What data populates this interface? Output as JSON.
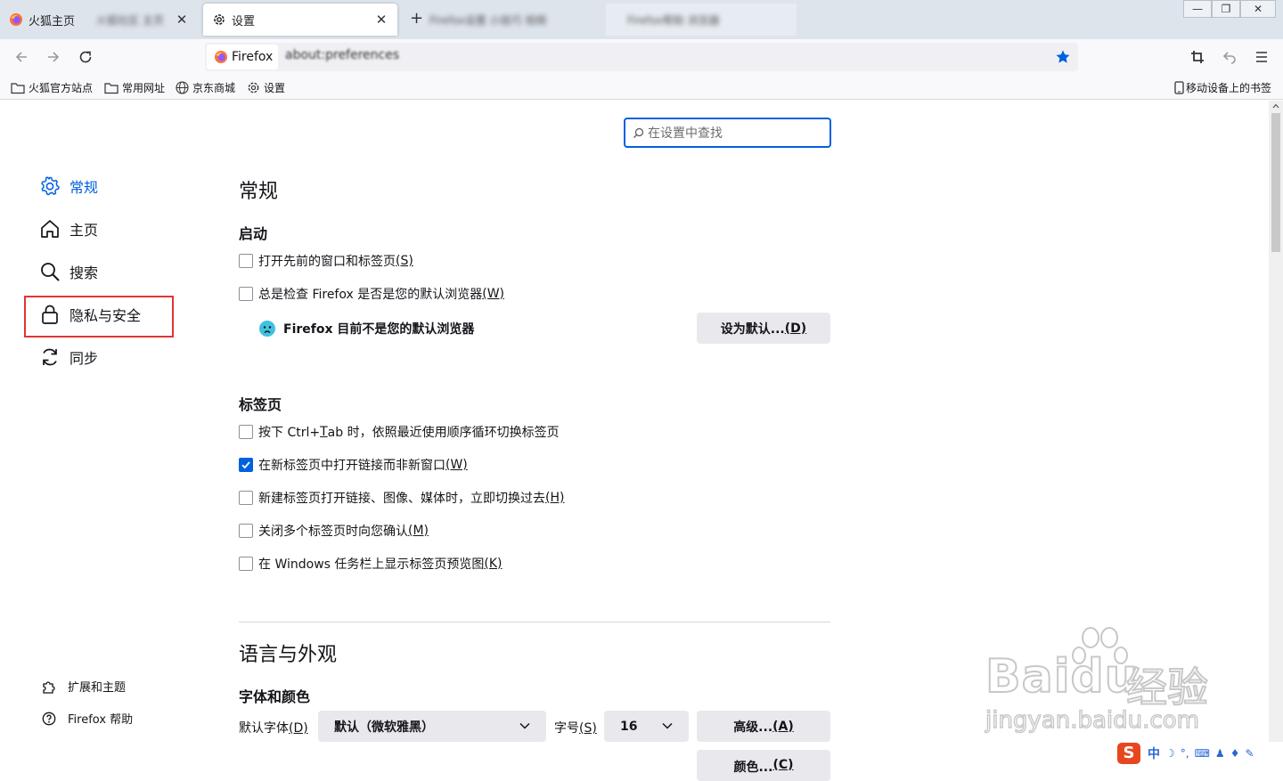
{
  "tabs": [
    {
      "title": "火狐主页",
      "blur_extra": "火狐社区 主页",
      "active": false
    },
    {
      "title": "设置",
      "active": true
    },
    {
      "title": "Firefox设置 小技巧 视频",
      "active": false
    },
    {
      "title": "Firefox帮助 浏览器",
      "active": false
    }
  ],
  "window_controls": {
    "minimize": "—",
    "restore": "❐",
    "close": "✕"
  },
  "urlbar": {
    "identity": "Firefox",
    "url": "about:preferences"
  },
  "bookmarks": [
    {
      "label": "火狐官方站点",
      "icon": "folder-icon"
    },
    {
      "label": "常用网址",
      "icon": "folder-icon"
    },
    {
      "label": "京东商城",
      "icon": "globe-icon"
    },
    {
      "label": "设置",
      "icon": "gear-icon"
    }
  ],
  "mobile_bookmarks": "移动设备上的书签",
  "search": {
    "placeholder": "在设置中查找"
  },
  "categories": [
    {
      "label": "常规",
      "icon": "gear-icon",
      "selected": true
    },
    {
      "label": "主页",
      "icon": "home-icon"
    },
    {
      "label": "搜索",
      "icon": "search-icon"
    },
    {
      "label": "隐私与安全",
      "icon": "lock-icon"
    },
    {
      "label": "同步",
      "icon": "sync-icon"
    }
  ],
  "sidebar_footer": {
    "extensions": "扩展和主题",
    "help": "Firefox 帮助"
  },
  "pane": {
    "title": "常规",
    "startup": {
      "heading": "启动",
      "restore_session": {
        "text": "打开先前的窗口和标签页",
        "key": "(S)",
        "checked": false
      },
      "check_default": {
        "text": "总是检查 Firefox 是否是您的默认浏览器",
        "key": "(W)",
        "checked": false
      },
      "not_default_msg": "Firefox 目前不是您的默认浏览器",
      "set_default_btn": {
        "text": "设为默认...",
        "key": "(D)"
      }
    },
    "tabs": {
      "heading": "标签页",
      "items": [
        {
          "pre": "按下 Ctrl+",
          "key": "T",
          "post": "ab 时，依照最近使用顺序循环切换标签页",
          "checked": false
        },
        {
          "pre": "在新标签页中打开链接而非新窗口",
          "key": "(W)",
          "post": "",
          "checked": true
        },
        {
          "pre": "新建标签页打开链接、图像、媒体时，立即切换过去",
          "key": "(H)",
          "post": "",
          "checked": false
        },
        {
          "pre": "关闭多个标签页时向您确认",
          "key": "(M)",
          "post": "",
          "checked": false
        },
        {
          "pre": "在 Windows 任务栏上显示标签页预览图",
          "key": "(K)",
          "post": "",
          "checked": false
        }
      ]
    },
    "language": {
      "title": "语言与外观",
      "fonts_heading": "字体和颜色",
      "default_font_label": "默认字体",
      "default_font_key": "(D)",
      "default_font_value": "默认（微软雅黑）",
      "size_label": "字号",
      "size_key": "(S)",
      "size_value": "16",
      "advanced_btn": "高级...",
      "advanced_key": "(A)",
      "colors_btn": "颜色...",
      "colors_key": "(C)"
    }
  },
  "watermark": {
    "brand": "Baidu",
    "sub": "经验",
    "url": "jingyan.baidu.com"
  },
  "ime": {
    "mode": "中",
    "logo": "S"
  },
  "colors": {
    "accent": "#0061e0",
    "highlight_box": "#e03535"
  }
}
